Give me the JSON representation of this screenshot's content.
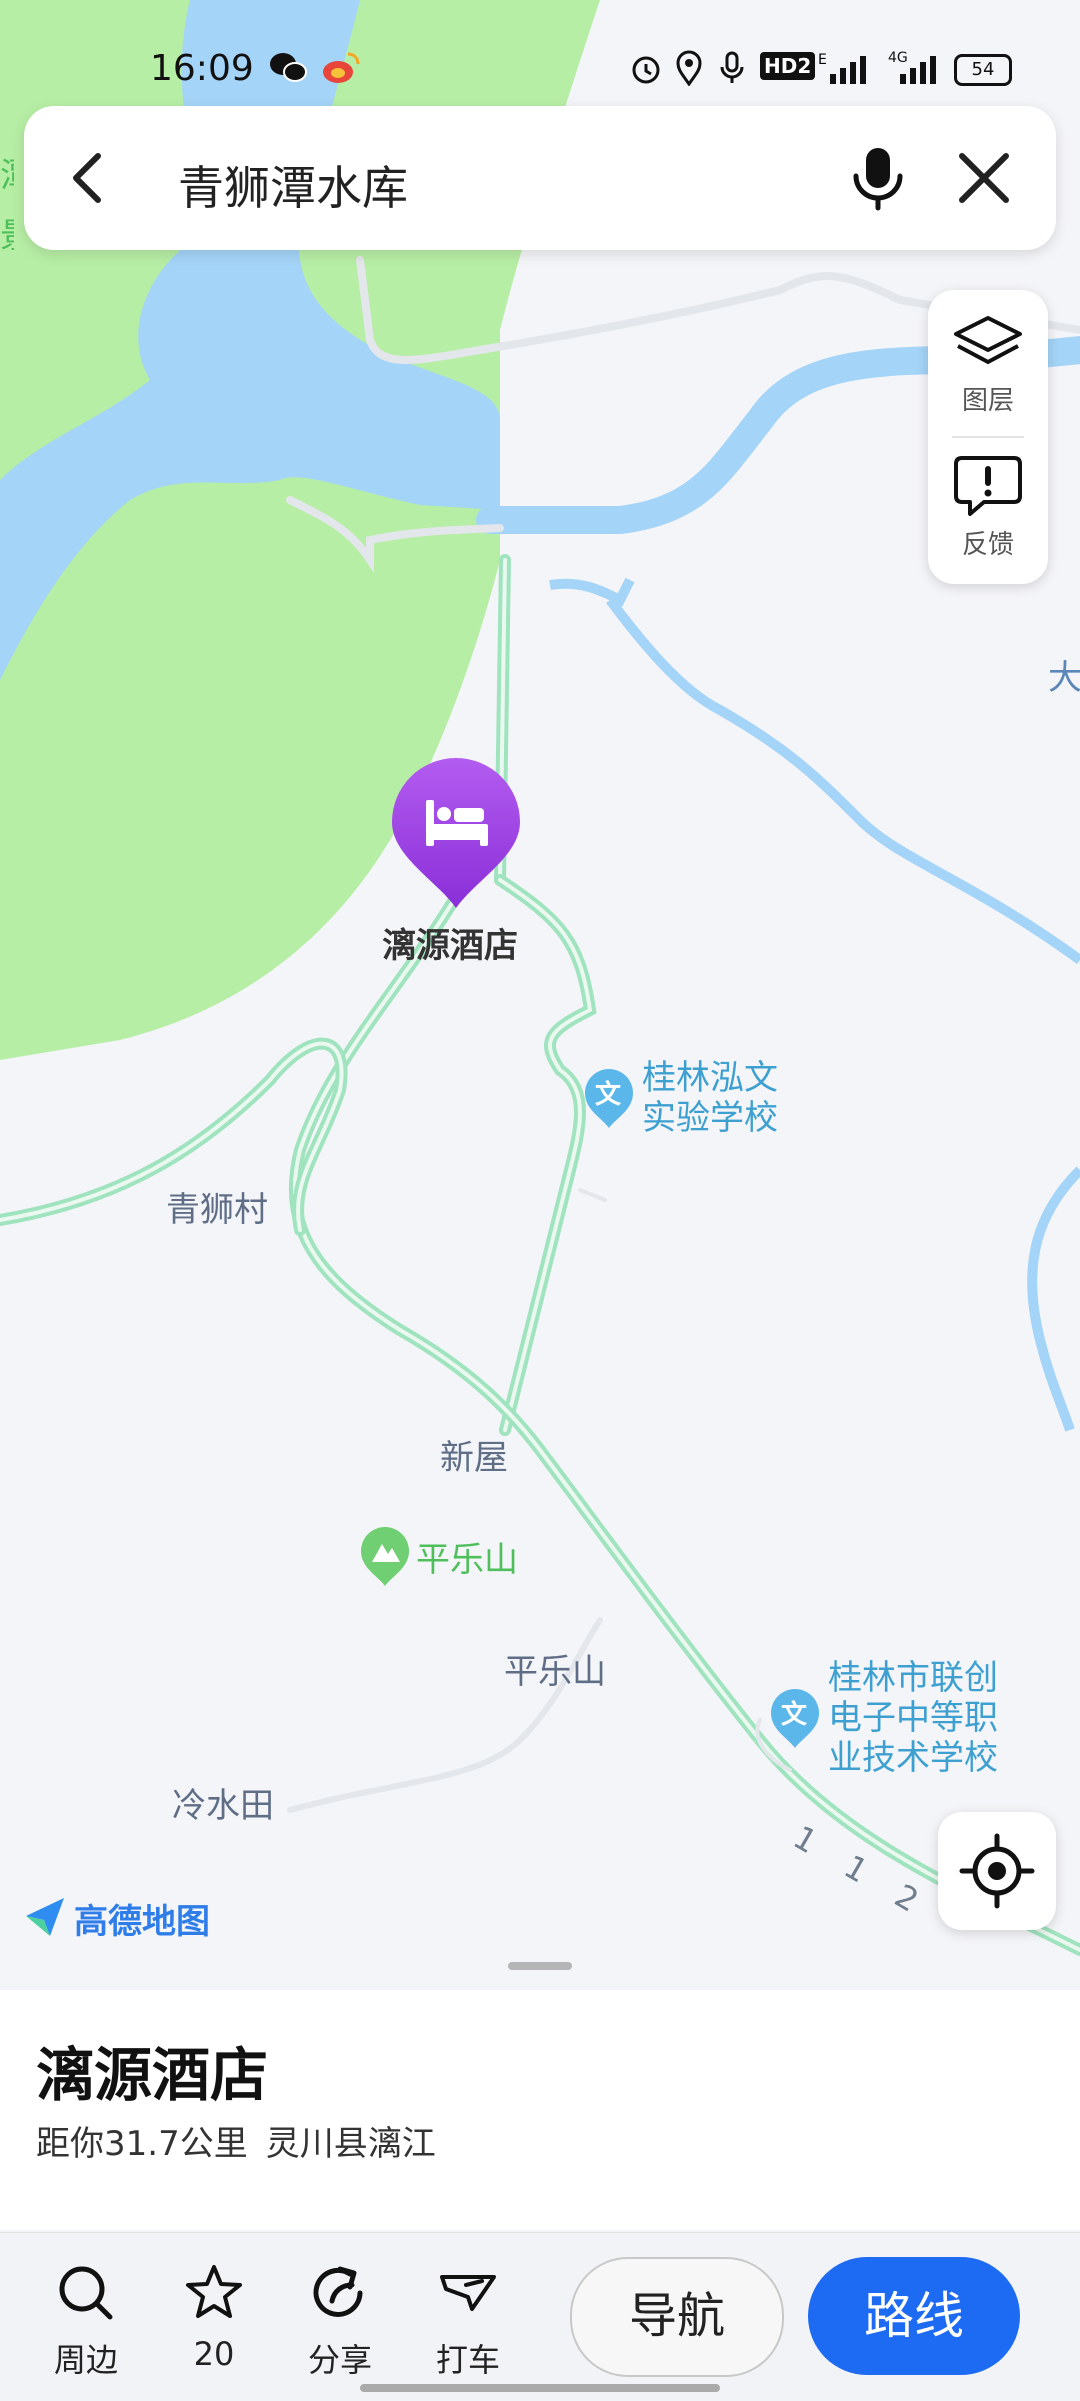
{
  "status_bar": {
    "time": "16:09",
    "battery": "54",
    "network": "4G",
    "hd": "HD2",
    "icons": [
      "wechat-icon",
      "weibo-icon",
      "alarm-icon",
      "location-icon",
      "mic-icon",
      "hd-icon",
      "signal-e-icon",
      "signal-4g-icon",
      "battery-icon"
    ]
  },
  "search": {
    "query": "青狮潭水库"
  },
  "tools": {
    "layers_label": "图层",
    "feedback_label": "反馈"
  },
  "map": {
    "marker_label": "漓源酒店",
    "labels": {
      "school1_line1": "桂林泓文",
      "school1_line2": "实验学校",
      "village_qingshi": "青狮村",
      "xinwu": "新屋",
      "pingle_poi": "平乐山",
      "pingle_area": "平乐山",
      "lengshuitian": "冷水田",
      "school2_line1": "桂林市联创",
      "school2_line2": "电子中等职",
      "school2_line3": "业技术学校",
      "road_number": "1 1 2",
      "edge_right": "大",
      "edge_left_top": "潭",
      "edge_left_bottom": "景"
    },
    "poi_badge": "文",
    "logo_text": "高德地图",
    "colors": {
      "water": "#a4d4f7",
      "green": "#b7eea5",
      "road": "#9fe3bf",
      "marker": "#9a3fe0"
    }
  },
  "sheet": {
    "title": "漓源酒店",
    "distance": "距你31.7公里",
    "region": "灵川县漓江"
  },
  "bottom_bar": {
    "nearby": "周边",
    "favorites": "20",
    "share": "分享",
    "taxi": "打车",
    "navigate": "导航",
    "route": "路线"
  }
}
